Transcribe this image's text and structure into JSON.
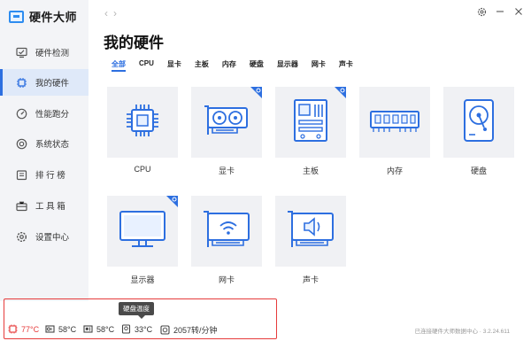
{
  "app": {
    "title": "硬件大师"
  },
  "sidebar": {
    "items": [
      {
        "label": "硬件检测",
        "icon": "monitor-check-icon"
      },
      {
        "label": "我的硬件",
        "icon": "cpu-chip-icon",
        "active": true
      },
      {
        "label": "性能跑分",
        "icon": "speedometer-icon"
      },
      {
        "label": "系统状态",
        "icon": "target-icon"
      },
      {
        "label": "排 行 榜",
        "icon": "ranking-icon"
      },
      {
        "label": "工 具 箱",
        "icon": "toolbox-icon"
      },
      {
        "label": "设置中心",
        "icon": "gear-icon"
      }
    ]
  },
  "header": {
    "page_title": "我的硬件"
  },
  "tabs": [
    "全部",
    "CPU",
    "显卡",
    "主板",
    "内存",
    "硬盘",
    "显示器",
    "网卡",
    "声卡"
  ],
  "active_tab": "全部",
  "cards": [
    {
      "label": "CPU",
      "icon": "cpu-icon",
      "badge": false
    },
    {
      "label": "显卡",
      "icon": "graphics-card-icon",
      "badge": true
    },
    {
      "label": "主板",
      "icon": "motherboard-icon",
      "badge": true
    },
    {
      "label": "内存",
      "icon": "ram-icon",
      "badge": false
    },
    {
      "label": "硬盘",
      "icon": "hard-disk-icon",
      "badge": false
    },
    {
      "label": "显示器",
      "icon": "monitor-icon",
      "badge": true
    },
    {
      "label": "网卡",
      "icon": "network-card-icon",
      "badge": false
    },
    {
      "label": "声卡",
      "icon": "sound-card-icon",
      "badge": false
    }
  ],
  "status": {
    "cpu_temp": "77°C",
    "gpu_temp": "58°C",
    "board_temp": "58°C",
    "disk_temp": "33°C",
    "fan_speed": "2057转/分钟",
    "tooltip": "硬盘温度",
    "footer": "已连接硬件大师数据中心 · 3.2.24.611"
  },
  "colors": {
    "accent": "#2d6fe0",
    "alert": "#e63b3b",
    "card_bg": "#f0f1f4",
    "sidebar_bg": "#f3f4f7"
  }
}
